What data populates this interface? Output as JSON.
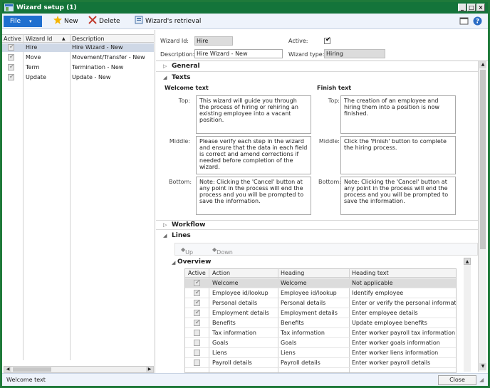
{
  "window": {
    "title": "Wizard setup (1)",
    "controls": {
      "minimize": "_",
      "maximize": "□",
      "close": "×"
    }
  },
  "toolbar": {
    "file_label": "File",
    "file_caret": "▾",
    "new_label": "New",
    "delete_label": "Delete",
    "retrieval_label": "Wizard's retrieval"
  },
  "left_grid": {
    "headers": {
      "active": "Active",
      "wizard_id": "Wizard Id",
      "sort": "▲",
      "description": "Description"
    },
    "rows": [
      {
        "active": true,
        "wizard_id": "Hire",
        "description": "Hire Wizard - New"
      },
      {
        "active": true,
        "wizard_id": "Move",
        "description": "Movement/Transfer - New"
      },
      {
        "active": true,
        "wizard_id": "Term",
        "description": "Termination - New"
      },
      {
        "active": true,
        "wizard_id": "Update",
        "description": "Update - New"
      }
    ]
  },
  "header": {
    "wizard_id_label": "Wizard Id:",
    "wizard_id_value": "Hire",
    "active_label": "Active:",
    "active_checked": true,
    "description_label": "Description:",
    "description_value": "Hire Wizard - New",
    "wizard_type_label": "Wizard type:",
    "wizard_type_value": "Hiring"
  },
  "fasttabs": {
    "general": "General",
    "texts": "Texts",
    "workflow": "Workflow",
    "lines": "Lines",
    "overview": "Overview"
  },
  "texts": {
    "welcome_heading": "Welcome text",
    "finish_heading": "Finish text",
    "top_label": "Top:",
    "middle_label": "Middle:",
    "bottom_label": "Bottom:",
    "welcome_top": "This wizard will guide you through the process of hiring or rehiring an existing employee into a vacant position.",
    "welcome_middle": "Please verify each step in the wizard and ensure that the data in each field is correct and amend corrections if needed before completion of the wizard.",
    "welcome_bottom": "Note: Clicking the 'Cancel' button at any point in the process will end the process and you will be prompted to save the information.",
    "finish_top": "The creation of an employee and hiring them into a position is now finished.",
    "finish_middle": "Click the 'Finish' button to complete the hiring process.",
    "finish_bottom": "Note: Clicking the 'Cancel' button at any point in the process will end the process and you will be prompted to save the information."
  },
  "lines_toolbar": {
    "up_label": "Up",
    "down_label": "Down"
  },
  "overview": {
    "headers": {
      "active": "Active",
      "action": "Action",
      "heading": "Heading",
      "heading_text": "Heading text"
    },
    "rows": [
      {
        "active": true,
        "action": "Welcome",
        "heading": "Welcome",
        "heading_text": "Not applicable"
      },
      {
        "active": true,
        "action": "Employee id/lookup",
        "heading": "Employee id/lookup",
        "heading_text": "Identify employee"
      },
      {
        "active": true,
        "action": "Personal details",
        "heading": "Personal details",
        "heading_text": "Enter or verify the personal information"
      },
      {
        "active": true,
        "action": "Employment details",
        "heading": "Employment details",
        "heading_text": "Enter employee details"
      },
      {
        "active": true,
        "action": "Benefits",
        "heading": "Benefits",
        "heading_text": "Update employee benefits"
      },
      {
        "active": false,
        "action": "Tax information",
        "heading": "Tax information",
        "heading_text": "Enter worker payroll tax information"
      },
      {
        "active": false,
        "action": "Goals",
        "heading": "Goals",
        "heading_text": "Enter worker goals information"
      },
      {
        "active": false,
        "action": "Liens",
        "heading": "Liens",
        "heading_text": "Enter worker liens information"
      },
      {
        "active": false,
        "action": "Payroll details",
        "heading": "Payroll details",
        "heading_text": "Enter worker payroll details"
      }
    ]
  },
  "status": {
    "text": "Welcome text",
    "close_label": "Close"
  },
  "colors": {
    "title_bar": "#14743a",
    "file_button": "#1f6fcf",
    "selected_row": "#cfd8e6"
  }
}
